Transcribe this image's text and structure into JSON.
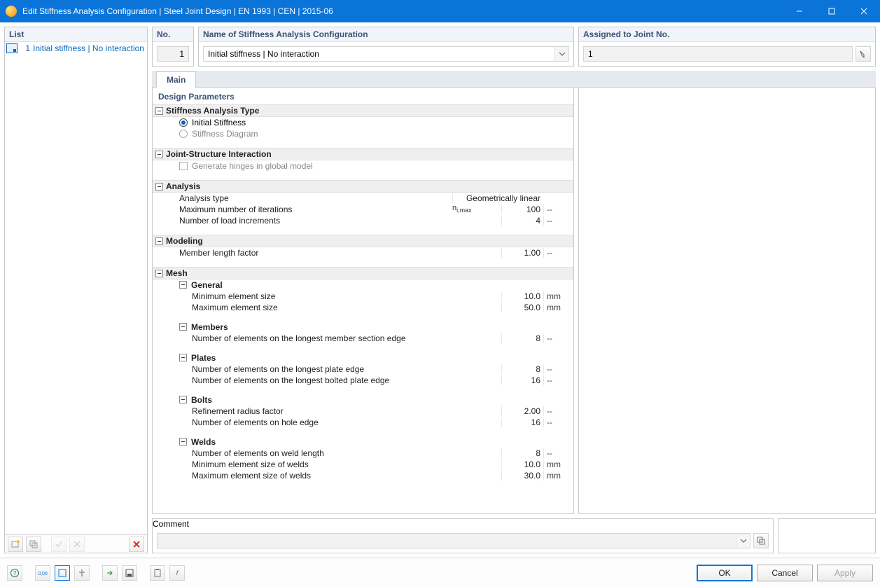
{
  "window": {
    "title": "Edit Stiffness Analysis Configuration | Steel Joint Design | EN 1993 | CEN | 2015-06"
  },
  "left": {
    "header": "List",
    "items": [
      {
        "no": "1",
        "label": "Initial stiffness | No interaction"
      }
    ]
  },
  "header": {
    "no_label": "No.",
    "no_value": "1",
    "name_label": "Name of Stiffness Analysis Configuration",
    "name_value": "Initial stiffness | No interaction",
    "assigned_label": "Assigned to Joint No.",
    "assigned_value": "1"
  },
  "tabs": {
    "main": "Main"
  },
  "params": {
    "section_title": "Design Parameters",
    "g1": {
      "title": "Stiffness Analysis Type",
      "opt1": "Initial Stiffness",
      "opt2": "Stiffness Diagram"
    },
    "g2": {
      "title": "Joint-Structure Interaction",
      "opt1": "Generate hinges in global model"
    },
    "g3": {
      "title": "Analysis",
      "r1_label": "Analysis type",
      "r1_value": "Geometrically linear",
      "r2_label": "Maximum number of iterations",
      "r2_sym": "n",
      "r2_sub": "i,max",
      "r2_value": "100",
      "r2_unit": "--",
      "r3_label": "Number of load increments",
      "r3_value": "4",
      "r3_unit": "--"
    },
    "g4": {
      "title": "Modeling",
      "r1_label": "Member length factor",
      "r1_value": "1.00",
      "r1_unit": "--"
    },
    "g5": {
      "title": "Mesh",
      "s1": {
        "title": "General",
        "r1_label": "Minimum element size",
        "r1_value": "10.0",
        "r1_unit": "mm",
        "r2_label": "Maximum element size",
        "r2_value": "50.0",
        "r2_unit": "mm"
      },
      "s2": {
        "title": "Members",
        "r1_label": "Number of elements on the longest member section edge",
        "r1_value": "8",
        "r1_unit": "--"
      },
      "s3": {
        "title": "Plates",
        "r1_label": "Number of elements on the longest plate edge",
        "r1_value": "8",
        "r1_unit": "--",
        "r2_label": "Number of elements on the longest bolted plate edge",
        "r2_value": "16",
        "r2_unit": "--"
      },
      "s4": {
        "title": "Bolts",
        "r1_label": "Refinement radius factor",
        "r1_value": "2.00",
        "r1_unit": "--",
        "r2_label": "Number of elements on hole edge",
        "r2_value": "16",
        "r2_unit": "--"
      },
      "s5": {
        "title": "Welds",
        "r1_label": "Number of elements on weld length",
        "r1_value": "8",
        "r1_unit": "--",
        "r2_label": "Minimum element size of welds",
        "r2_value": "10.0",
        "r2_unit": "mm",
        "r3_label": "Maximum element size of welds",
        "r3_value": "30.0",
        "r3_unit": "mm"
      }
    }
  },
  "comment": {
    "label": "Comment",
    "value": ""
  },
  "footer": {
    "ok": "OK",
    "cancel": "Cancel",
    "apply": "Apply"
  }
}
